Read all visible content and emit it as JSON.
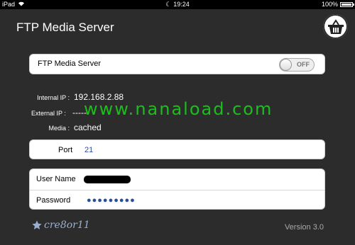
{
  "status_bar": {
    "device": "iPad",
    "time": "19:24",
    "battery": "100%",
    "battery_level": 1.0
  },
  "header": {
    "title": "FTP Media Server"
  },
  "server_toggle": {
    "label": "FTP Media Server",
    "state": "OFF"
  },
  "info": {
    "internal_ip_label": "Internal IP :",
    "internal_ip_value": "192.168.2.88",
    "external_ip_label": "External IP :",
    "external_ip_value": "-----",
    "media_label": "Media :",
    "media_value": "cached"
  },
  "watermark": "www.nanaload.com",
  "port": {
    "label": "Port",
    "value": "21"
  },
  "login": {
    "username_label": "User Name",
    "password_label": "Password",
    "password_value": "●●●●●●●●●"
  },
  "footer": {
    "logo_text": "cre8or11",
    "version": "Version 3.0"
  },
  "colors": {
    "background": "#2c2c2c",
    "value_blue": "#2a4d9c",
    "watermark_green": "#1bbf1b"
  }
}
